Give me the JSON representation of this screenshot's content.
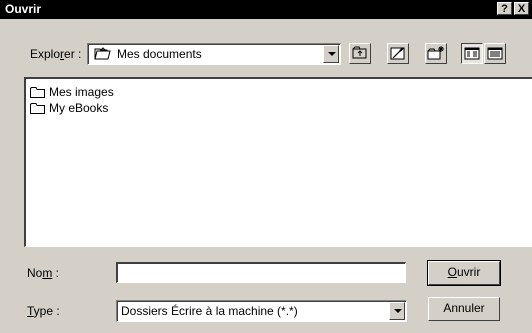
{
  "window": {
    "title": "Ouvrir",
    "help_label": "?",
    "close_label": "X"
  },
  "location": {
    "label_prefix": "Explo",
    "label_accel": "r",
    "label_suffix": "er :",
    "current_folder": "Mes documents"
  },
  "files": [
    {
      "name": "Mes images",
      "icon": "folder-icon"
    },
    {
      "name": "My eBooks",
      "icon": "folder-icon"
    }
  ],
  "filename": {
    "label_prefix": "No",
    "label_accel": "m",
    "label_suffix": " :",
    "value": ""
  },
  "filetype": {
    "label_accel": "T",
    "label_suffix": "ype :",
    "value": "Dossiers Écrire à la machine (*.*)"
  },
  "buttons": {
    "open_accel": "O",
    "open_rest": "uvrir",
    "cancel": "Annuler"
  }
}
